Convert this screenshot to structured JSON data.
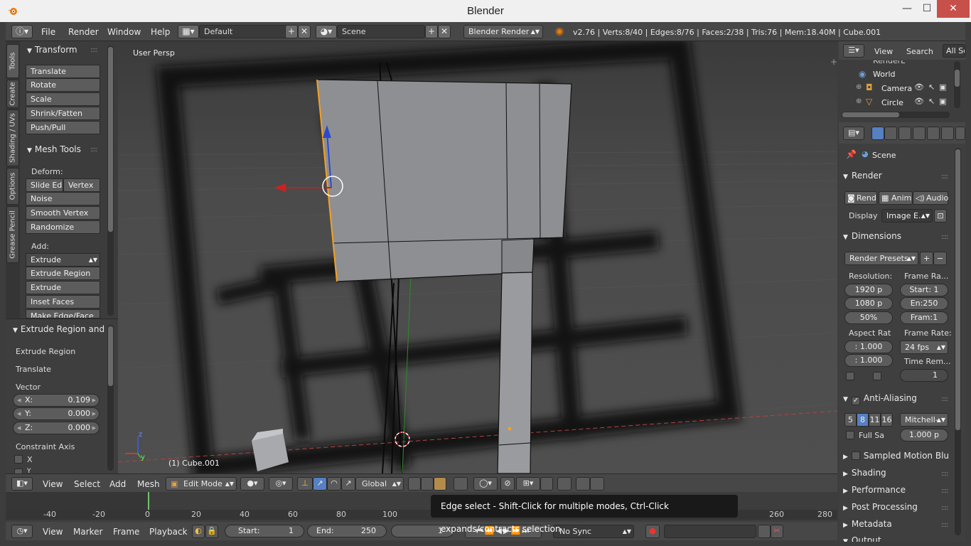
{
  "window": {
    "title": "Blender",
    "minimize": "—",
    "maximize": "☐",
    "close": "✕"
  },
  "top": {
    "menus": [
      "File",
      "Render",
      "Window",
      "Help"
    ],
    "layout": "Default",
    "scene": "Scene",
    "engine": "Blender Render",
    "stats": "v2.76 | Verts:8/40 | Edges:8/76 | Faces:2/38 | Tris:76 | Mem:18.40M | Cube.001"
  },
  "lefttabs": [
    "Tools",
    "Create",
    "Shading / UVs",
    "Options",
    "Grease Pencil"
  ],
  "tools": {
    "transform_title": "Transform",
    "transform": [
      "Translate",
      "Rotate",
      "Scale",
      "Shrink/Fatten",
      "Push/Pull"
    ],
    "meshtools_title": "Mesh Tools",
    "deform_label": "Deform:",
    "slide_edge": "Slide Ed",
    "vertex": "Vertex",
    "deform": [
      "Noise",
      "Smooth Vertex",
      "Randomize"
    ],
    "add_label": "Add:",
    "extrude": "Extrude",
    "add": [
      "Extrude Region",
      "Extrude Individual",
      "Inset Faces",
      "Make Edge/Face"
    ]
  },
  "operator": {
    "title": "Extrude Region and",
    "item1": "Extrude Region",
    "item2": "Translate",
    "vector_label": "Vector",
    "x_label": "X:",
    "x": "0.109",
    "y_label": "Y:",
    "y": "0.000",
    "z_label": "Z:",
    "z": "0.000",
    "constraint_label": "Constraint Axis",
    "cx": "X",
    "cy": "Y"
  },
  "viewport": {
    "view_label": "User Persp",
    "object_label": "(1) Cube.001"
  },
  "viewheader": {
    "menus": [
      "View",
      "Select",
      "Add",
      "Mesh"
    ],
    "mode": "Edit Mode",
    "orientation": "Global"
  },
  "timeline": {
    "ticks": [
      "-40",
      "-20",
      "0",
      "20",
      "40",
      "60",
      "80",
      "100",
      "260",
      "280"
    ],
    "menus": [
      "View",
      "Marker",
      "Frame",
      "Playback"
    ],
    "start_label": "Start:",
    "start": "1",
    "end_label": "End:",
    "end": "250",
    "current": "1",
    "sync": "No Sync"
  },
  "tooltip": {
    "text": "Edge select - Shift-Click for multiple modes, Ctrl-Click expands/contracts selection"
  },
  "outliner": {
    "view": "View",
    "search": "Search",
    "filter": "All Sc",
    "items": [
      "RenderL",
      "World",
      "Camera",
      "Circle"
    ]
  },
  "props": {
    "scene": "Scene",
    "render_title": "Render",
    "tab_render": "Rend",
    "tab_anim": "Anim",
    "tab_audio": "Audio",
    "display_label": "Display",
    "display_value": "Image E...",
    "dimensions_title": "Dimensions",
    "presets": "Render Presets",
    "resolution_label": "Resolution:",
    "res_x": "1920 p",
    "res_y": "1080 p",
    "res_pct": "50%",
    "framerange_label": "Frame Ra...",
    "start": "Start: 1",
    "end": "En:250",
    "frame": "Fram:1",
    "aspect_label": "Aspect Rat",
    "aspect_x": ": 1.000",
    "aspect_y": ": 1.000",
    "framerate_label": "Frame Rate:",
    "framerate": "24 fps",
    "timeremap_label": "Time Rem...",
    "timeremap": "1",
    "aa_title": "Anti-Aliasing",
    "aa_samples": [
      "5",
      "8",
      "11",
      "16"
    ],
    "filter": "Mitchell-",
    "fullsample": "Full Sa",
    "filter_size": "1.000 p",
    "sections": [
      "Sampled Motion Blur",
      "Shading",
      "Performance",
      "Post Processing",
      "Metadata",
      "Output"
    ]
  },
  "colors": {
    "accent": "#5680c2",
    "selected_edge": "#f5a020",
    "bg": "#3d3d3d"
  }
}
